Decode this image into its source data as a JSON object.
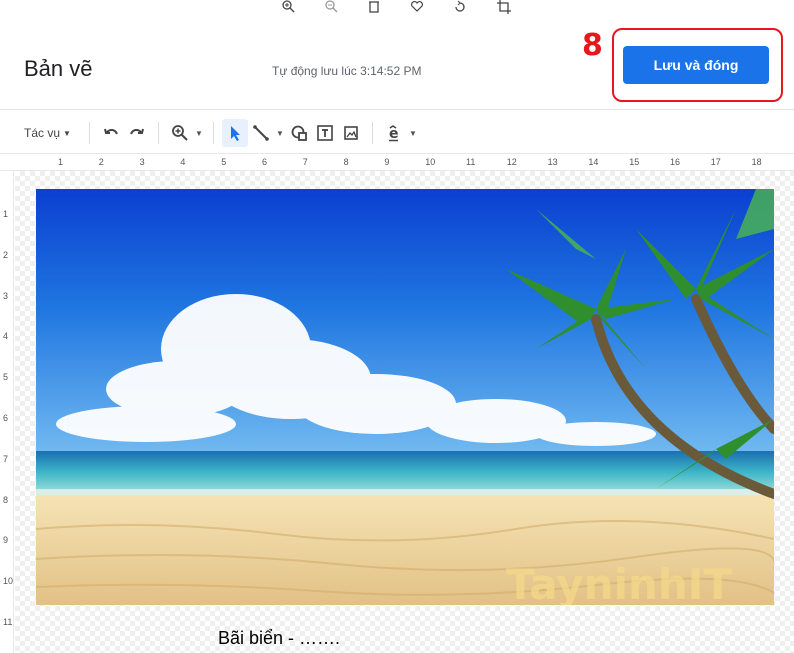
{
  "header": {
    "title": "Bản vẽ",
    "autosave_text": "Tự động lưu lúc 3:14:52 PM",
    "save_button_label": "Lưu và đóng",
    "step_number": "8"
  },
  "toolbar": {
    "actions_label": "Tác vụ",
    "items": [
      "undo-icon",
      "redo-icon",
      "zoom-icon",
      "select-icon",
      "line-icon",
      "shape-icon",
      "textbox-icon",
      "image-icon",
      "font-icon"
    ]
  },
  "ruler": {
    "horizontal": [
      "1",
      "2",
      "3",
      "4",
      "5",
      "6",
      "7",
      "8",
      "9",
      "10",
      "11",
      "12",
      "13",
      "14",
      "15",
      "16",
      "17",
      "18"
    ],
    "vertical": [
      "1",
      "2",
      "3",
      "4",
      "5",
      "6",
      "7",
      "8",
      "9",
      "10",
      "11"
    ]
  },
  "canvas": {
    "watermark": "TayninhIT",
    "caption": "Bãi biển - ……."
  },
  "colors": {
    "primary": "#1a73e8",
    "highlight": "#e8171b"
  }
}
